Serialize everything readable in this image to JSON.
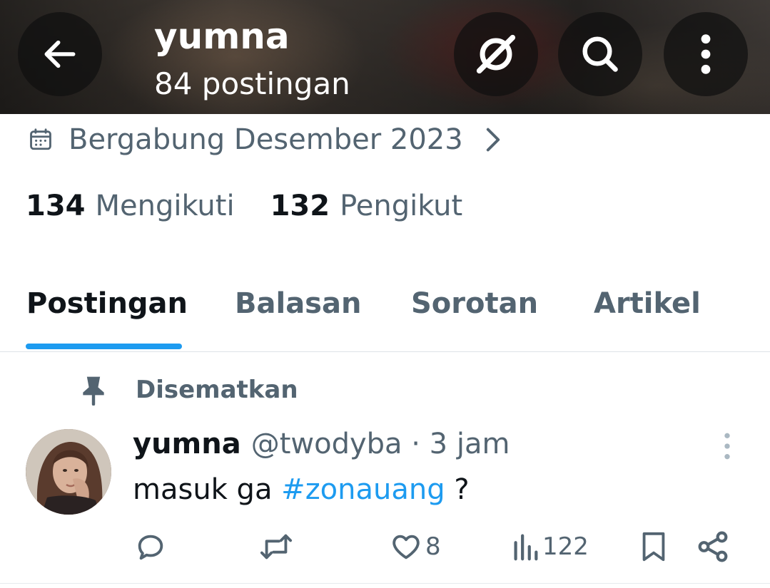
{
  "header": {
    "title": "yumna",
    "subtitle": "84 postingan",
    "icons": {
      "back": "arrow-left-icon",
      "grok": "grok-icon",
      "search": "search-icon",
      "more": "more-vertical-icon"
    }
  },
  "profile": {
    "joined": "Bergabung Desember 2023",
    "following_count": "134",
    "following_label": "Mengikuti",
    "followers_count": "132",
    "followers_label": "Pengikut"
  },
  "tabs": [
    {
      "label": "Postingan",
      "active": true
    },
    {
      "label": "Balasan",
      "active": false
    },
    {
      "label": "Sorotan",
      "active": false
    },
    {
      "label": "Artikel",
      "active": false
    }
  ],
  "pinned_label": "Disematkan",
  "post": {
    "name": "yumna",
    "handle_time": "@twodyba · 3 jam",
    "text_before": "masuk ga ",
    "hashtag": "#zonauang",
    "text_after": " ?",
    "likes": "8",
    "views": "122"
  },
  "colors": {
    "accent": "#1d9bf0",
    "text": "#0f1419",
    "secondary": "#536471"
  }
}
